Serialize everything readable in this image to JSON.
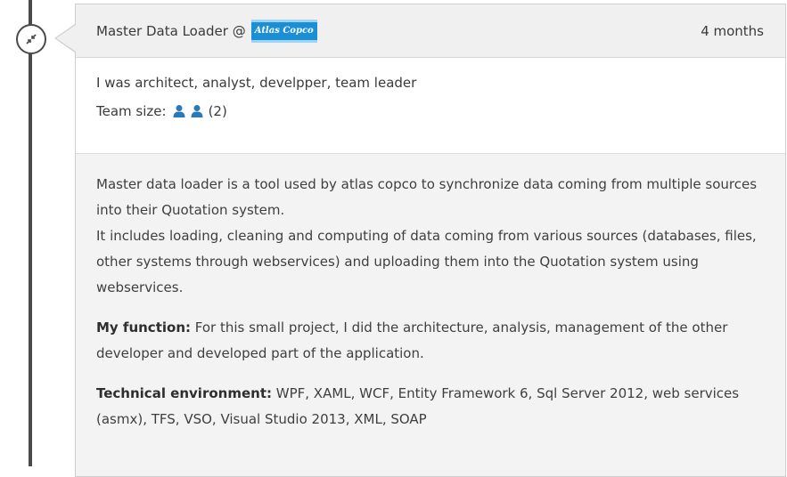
{
  "job": {
    "title": "Master Data Loader @",
    "company_logo_text": "Atlas Copco",
    "duration": "4 months",
    "role": "I was architect, analyst, develpper, team leader",
    "team_size_label": "Team size:",
    "team_size_value": "(2)",
    "description": [
      "Master data loader is a tool used by atlas copco to synchronize data coming from multiple sources into their Quotation system.",
      "It includes loading, cleaning and computing of data coming from various sources (databases, files, other systems through webservices) and uploading them into the Quotation system using webservices."
    ],
    "function_label": "My function:",
    "function_text": " For this small project, I did the architecture, analysis, management of the other developer and developed part of the application.",
    "tech_label": "Technical environment:",
    "tech_text": " WPF, XAML, WCF, Entity Framework 6, Sql Server 2012, web services (asmx), TFS, VSO, Visual Studio 2013, XML, SOAP"
  },
  "icons": {
    "timeline_node": "collapse-arrows-icon",
    "team_member": "user-icon"
  },
  "colors": {
    "logo_blue": "#1a8fd6",
    "person_icon": "#2a7ab8",
    "timeline": "#4a4a4a"
  }
}
